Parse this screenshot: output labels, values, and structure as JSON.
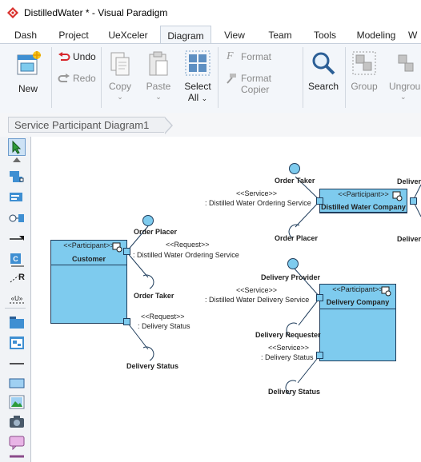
{
  "window": {
    "title": "DistilledWater * - Visual Paradigm"
  },
  "tabs": [
    "Dash",
    "Project",
    "UeXceler",
    "Diagram",
    "View",
    "Team",
    "Tools",
    "Modeling",
    "W"
  ],
  "active_tab": "Diagram",
  "ribbon": {
    "new": "New",
    "undo": "Undo",
    "redo": "Redo",
    "copy": "Copy",
    "paste": "Paste",
    "select_all_1": "Select",
    "select_all_2": "All",
    "format": "Format",
    "format_copier": "Format Copier",
    "search": "Search",
    "group": "Group",
    "ungroup": "Ungroup"
  },
  "breadcrumb": "Service Participant Diagram1",
  "diagram": {
    "customer": {
      "stereotype": "<<Participant>>",
      "name": "Customer"
    },
    "distilled_water_company": {
      "stereotype": "<<Participant>>",
      "name": "Distilled Water Company"
    },
    "delivery_company": {
      "stereotype": "<<Participant>>",
      "name": "Delivery Company"
    },
    "labels": {
      "order_placer_1": "Order Placer",
      "request_1": "<<Request>>",
      "request_1_name": ": Distilled Water Ordering Service",
      "order_taker_1": "Order Taker",
      "request_2": "<<Request>>",
      "request_2_name": ": Delivery Status",
      "delivery_status_1": "Delivery Status",
      "order_taker_2": "Order Taker",
      "service_1": "<<Service>>",
      "service_1_name": ": Distilled Water Ordering Service",
      "order_placer_2": "Order Placer",
      "deliver_1": "Delivery",
      "deliver_2": "Delivery",
      "delivery_provider": "Delivery Provider",
      "service_2": "<<Service>>",
      "service_2_name": ": Distilled Water Delivery Service",
      "delivery_requester": "Delivery Requester",
      "service_3": "<<Service>>",
      "service_3_name": ": Delivery Status",
      "delivery_status_2": "Delivery Status"
    }
  }
}
